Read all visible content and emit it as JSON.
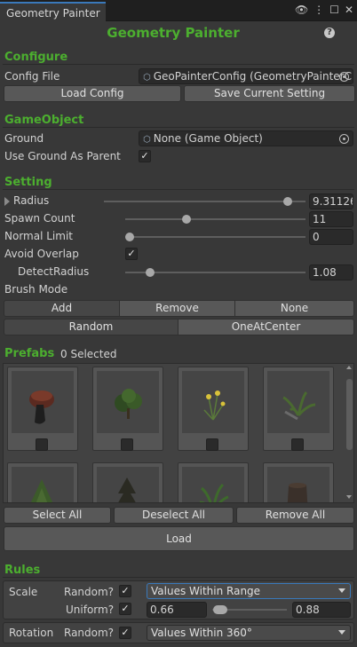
{
  "window": {
    "tab_title": "Geometry Painter",
    "tab_icons": [
      "visibility-icon",
      "more-icon",
      "maximize-icon",
      "close-icon"
    ]
  },
  "header": {
    "title": "Geometry Painter",
    "help_glyph": "?"
  },
  "configure": {
    "section": "Configure",
    "config_label": "Config File",
    "config_value": "GeoPainterConfig (GeometryPainterC",
    "load_btn": "Load Config",
    "save_btn": "Save Current Setting"
  },
  "gameobject": {
    "section": "GameObject",
    "ground_label": "Ground",
    "ground_value": "None (Game Object)",
    "use_parent_label": "Use Ground As Parent",
    "use_parent_checked": "✓"
  },
  "setting": {
    "section": "Setting",
    "radius_label": "Radius",
    "radius_value": "9.31126",
    "radius_fraction": 0.93,
    "spawn_label": "Spawn Count",
    "spawn_value": "11",
    "spawn_fraction": 0.33,
    "normal_label": "Normal Limit",
    "normal_value": "0",
    "normal_fraction": 0.0,
    "avoid_label": "Avoid Overlap",
    "avoid_checked": "✓",
    "detect_label": "DetectRadius",
    "detect_value": "1.08",
    "detect_fraction": 0.12,
    "brush_label": "Brush Mode",
    "brush_modes": [
      "Add",
      "Remove",
      "None"
    ],
    "brush_active": "Add",
    "spawn_modes": [
      "Random",
      "OneAtCenter"
    ],
    "spawn_active": "Random"
  },
  "prefabs": {
    "section": "Prefabs",
    "selected_text": "0 Selected",
    "items": [
      "mushroom",
      "bush",
      "dandelion",
      "fern",
      "shrub",
      "small-tree",
      "grass",
      "tree-stump"
    ],
    "select_all": "Select All",
    "deselect_all": "Deselect All",
    "remove_all": "Remove All",
    "load": "Load"
  },
  "rules": {
    "section": "Rules",
    "scale_label": "Scale",
    "random_label": "Random?",
    "uniform_label": "Uniform?",
    "scale_random_checked": "✓",
    "scale_uniform_checked": "✓",
    "scale_mode": "Values Within Range",
    "scale_min": "0.66",
    "scale_max": "0.88",
    "rotation_label": "Rotation",
    "rotation_random_checked": "✓",
    "rotation_mode": "Values Within 360°"
  },
  "colors": {
    "section_green": "#4caf2f",
    "accent_blue": "#3a79bb",
    "background": "#383838"
  }
}
